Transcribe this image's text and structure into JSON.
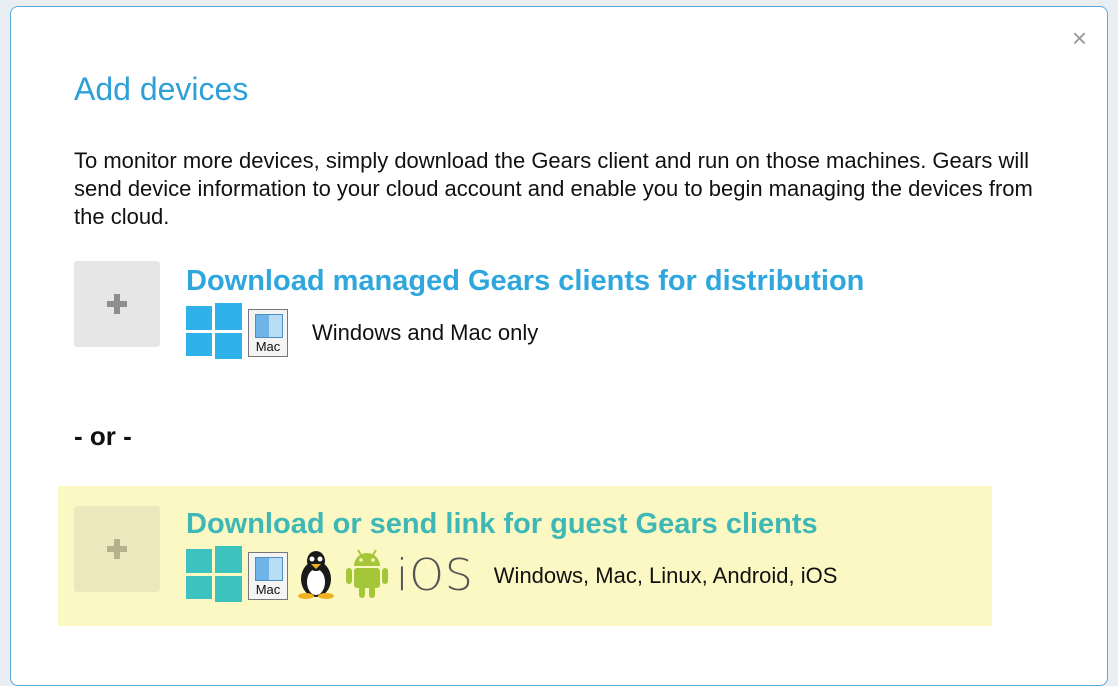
{
  "dialog": {
    "close_glyph": "×",
    "title": "Add devices",
    "description": "To monitor more devices, simply download the Gears client and run on those machines. Gears will send device information to your cloud account and enable you to begin managing the devices from the cloud."
  },
  "options": {
    "managed": {
      "link": "Download managed Gears clients for distribution",
      "platform_text": "Windows and Mac only",
      "icons": [
        "windows-icon",
        "mac-icon"
      ]
    },
    "separator": "- or -",
    "guest": {
      "link": "Download or send link for guest Gears clients",
      "platform_text": "Windows, Mac, Linux, Android, iOS",
      "icons": [
        "windows-icon",
        "mac-icon",
        "linux-icon",
        "android-icon",
        "ios-icon"
      ]
    }
  },
  "icon_labels": {
    "mac": "Mac",
    "ios": "iOS"
  },
  "colors": {
    "title": "#2f9fd8",
    "managed_link": "#2fa7dc",
    "guest_link": "#3db8b6",
    "guest_highlight": "#fbf8c4",
    "windows_blue": "#2fb2ea",
    "windows_teal": "#3dc3bf"
  }
}
